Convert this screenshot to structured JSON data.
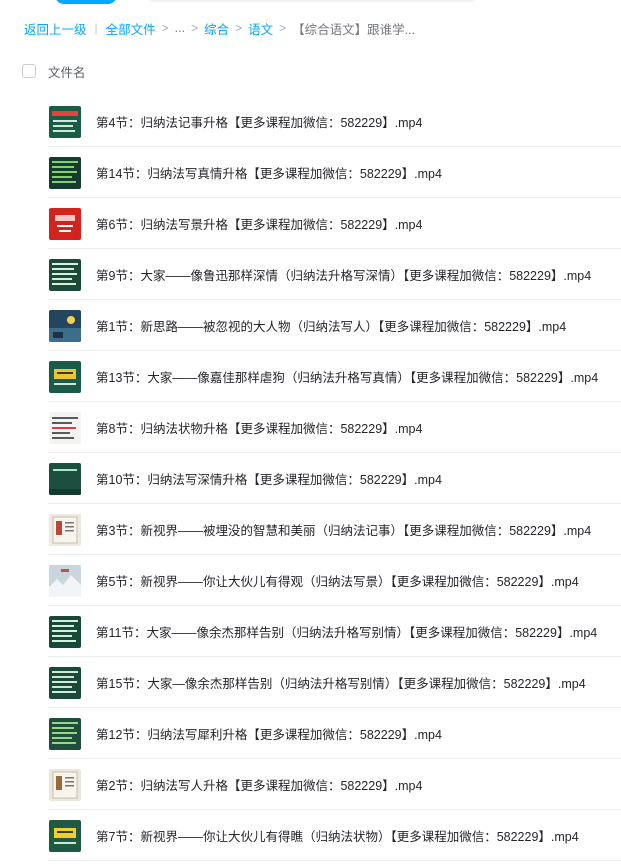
{
  "breadcrumb": {
    "back": "返回上一级",
    "all_files": "全部文件",
    "ellipsis": "...",
    "level1": "综合",
    "level2": "语文",
    "current": "【综合语文】跟谁学..."
  },
  "list_header": {
    "name_column": "文件名"
  },
  "files": [
    {
      "name": "第4节：归纳法记事升格【更多课程加微信：582229】.mp4",
      "thumb_bg": "#1b5c45",
      "thumb_accent": "#e8403a",
      "thumb_style": "redbar"
    },
    {
      "name": "第14节：归纳法写真情升格【更多课程加微信：582229】.mp4",
      "thumb_bg": "#163b2e",
      "thumb_accent": "#7fd36b",
      "thumb_style": "lines"
    },
    {
      "name": "第6节：归纳法写景升格【更多课程加微信：582229】.mp4",
      "thumb_bg": "#d2231f",
      "thumb_accent": "#f4c7c2",
      "thumb_style": "redcard"
    },
    {
      "name": "第9节：大家——像鲁迅那样深情（归纳法升格写深情）【更多课程加微信：582229】.mp4",
      "thumb_bg": "#1d4a38",
      "thumb_accent": "#d7f0dd",
      "thumb_style": "lines"
    },
    {
      "name": "第1节：新思路——被忽视的大人物（归纳法写人）【更多课程加微信：582229】.mp4",
      "thumb_bg": "#23465e",
      "thumb_accent": "#f2d24c",
      "thumb_style": "photo"
    },
    {
      "name": "第13节：大家——像嘉佳那样虐狗（归纳法升格写真情）【更多课程加微信：582229】.mp4",
      "thumb_bg": "#1a5a48",
      "thumb_accent": "#f0c431",
      "thumb_style": "yellowbox"
    },
    {
      "name": "第8节：归纳法状物升格【更多课程加微信：582229】.mp4",
      "thumb_bg": "#f3f3f1",
      "thumb_accent": "#5a5a5a",
      "thumb_style": "paper"
    },
    {
      "name": "第10节：归纳法写深情升格【更多课程加微信：582229】.mp4",
      "thumb_bg": "#1c4f3f",
      "thumb_accent": "#b7e3c8",
      "thumb_style": "plain"
    },
    {
      "name": "第3节：新视界——被埋没的智慧和美丽（归纳法记事）【更多课程加微信：582229】.mp4",
      "thumb_bg": "#efe9e0",
      "thumb_accent": "#b54a3c",
      "thumb_style": "book"
    },
    {
      "name": "第5节：新视界——你让大伙儿有得观（归纳法写景）【更多课程加微信：582229】.mp4",
      "thumb_bg": "#dfe6ea",
      "thumb_accent": "#c05050",
      "thumb_style": "snow"
    },
    {
      "name": "第11节：大家——像余杰那样告别（归纳法升格写别情）【更多课程加微信：582229】.mp4",
      "thumb_bg": "#17493a",
      "thumb_accent": "#d6efd9",
      "thumb_style": "lines"
    },
    {
      "name": "第15节：大家—像余杰那样告别（归纳法升格写别情）【更多课程加微信：582229】.mp4",
      "thumb_bg": "#18493a",
      "thumb_accent": "#cfe9d3",
      "thumb_style": "lines"
    },
    {
      "name": "第12节：归纳法写犀利升格【更多课程加微信：582229】.mp4",
      "thumb_bg": "#1d4f3c",
      "thumb_accent": "#9bd48a",
      "thumb_style": "lines"
    },
    {
      "name": "第2节：归纳法写人升格【更多课程加微信：582229】.mp4",
      "thumb_bg": "#ece7dc",
      "thumb_accent": "#9b6a3a",
      "thumb_style": "book"
    },
    {
      "name": "第7节：新视界——你让大伙儿有得瞧（归纳法状物）【更多课程加微信：582229】.mp4",
      "thumb_bg": "#1e5a42",
      "thumb_accent": "#f2cf2a",
      "thumb_style": "yellowbox"
    }
  ]
}
